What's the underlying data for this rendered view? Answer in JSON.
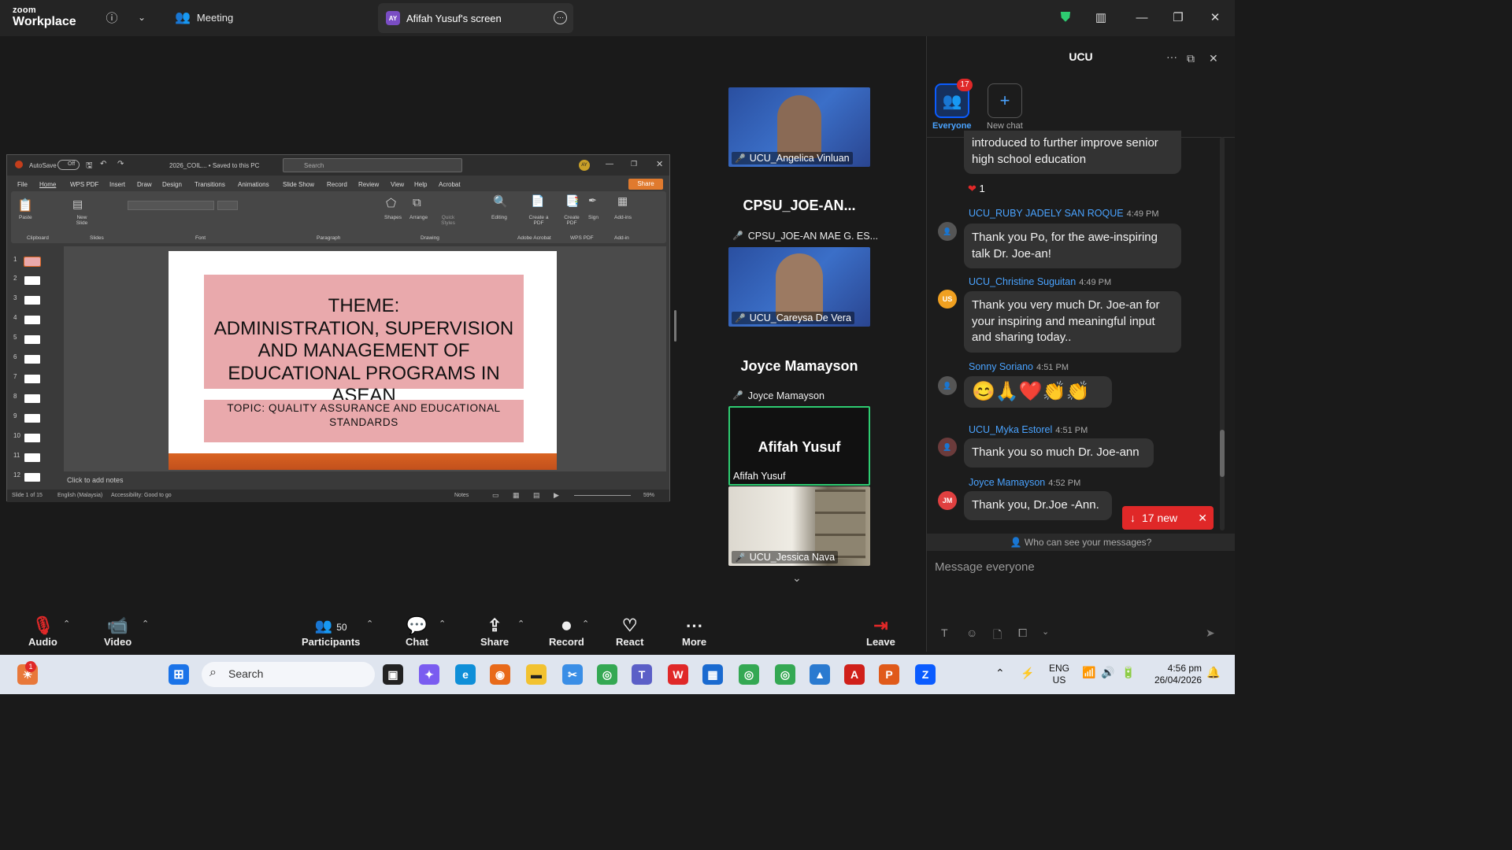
{
  "titlebar": {
    "logo_line1": "zoom",
    "logo_line2": "Workplace",
    "meeting_label": "Meeting",
    "screen_initials": "AY",
    "screen_label": "Afifah Yusuf's screen"
  },
  "ppt": {
    "autosave": "AutoSave",
    "autosave_state": "Off",
    "filename": "2026_COIL... • Saved to this PC",
    "search_placeholder": "Search",
    "share": "Share",
    "user_initials": "AY",
    "menu": [
      "File",
      "Home",
      "WPS PDF",
      "Insert",
      "Draw",
      "Design",
      "Transitions",
      "Animations",
      "Slide Show",
      "Record",
      "Review",
      "View",
      "Help",
      "Acrobat"
    ],
    "ribbon": {
      "paste": "Paste",
      "new_slide": "New Slide",
      "clipboard": "Clipboard",
      "slides": "Slides",
      "font": "Font",
      "paragraph": "Paragraph",
      "shapes": "Shapes",
      "arrange": "Arrange",
      "quick_styles": "Quick Styles",
      "drawing": "Drawing",
      "editing": "Editing",
      "create_pdf": "Create a PDF",
      "create_pdf2": "Create PDF",
      "sign": "Sign",
      "adobe": "Adobe Acrobat",
      "wps": "WPS PDF",
      "addins": "Add-ins",
      "addins_grp": "Add-in"
    },
    "slide_numbers": [
      "1",
      "2",
      "3",
      "4",
      "5",
      "6",
      "7",
      "8",
      "9",
      "10",
      "11",
      "12"
    ],
    "slide": {
      "theme": "THEME:\nADMINISTRATION, SUPERVISION\nAND MANAGEMENT OF\nEDUCATIONAL PROGRAMS IN ASEAN",
      "topic": "TOPIC: QUALITY ASSURANCE AND EDUCATIONAL\nSTANDARDS"
    },
    "notes": "Click to add notes",
    "status": {
      "slide": "Slide 1 of 15",
      "language": "English (Malaysia)",
      "accessibility": "Accessibility: Good to go",
      "notes": "Notes",
      "zoom": "59%"
    }
  },
  "gallery": {
    "angelica": "UCU_Angelica Vinluan",
    "cpsu_big": "CPSU_JOE-AN...",
    "cpsu_label": "CPSU_JOE-AN MAE G. ES...",
    "careysa": "UCU_Careysa De Vera",
    "joyce_big": "Joyce Mamayson",
    "joyce_label": "Joyce Mamayson",
    "afifah_big": "Afifah Yusuf",
    "afifah_label": "Afifah Yusuf",
    "jessica": "UCU_Jessica Nava"
  },
  "chat": {
    "title": "UCU",
    "everyone": "Everyone",
    "everyone_badge": "17",
    "new_chat": "New chat",
    "prev_text": "introduced to further improve senior high school education",
    "heart_count": "1",
    "messages": [
      {
        "name": "UCU_RUBY JADELY SAN ROQUE",
        "time": "4:49 PM",
        "text": "Thank you Po, for the awe-inspiring talk Dr. Joe-an!"
      },
      {
        "name": "UCU_Christine Suguitan",
        "time": "4:49 PM",
        "initials": "US",
        "text": "Thank you very much Dr. Joe-an for your inspiring and meaningful input and sharing today.."
      },
      {
        "name": "Sonny Soriano",
        "time": "4:51 PM",
        "text": "😊🙏❤️👏👏"
      },
      {
        "name": "UCU_Myka Estorel",
        "time": "4:51 PM",
        "text": "Thank you so much Dr. Joe-ann"
      },
      {
        "name": "Joyce Mamayson",
        "time": "4:52 PM",
        "initials": "JM",
        "text": "Thank you, Dr.Joe -Ann."
      }
    ],
    "new_badge": "17 new",
    "who_can_see": "Who can see your messages?",
    "input_placeholder": "Message everyone"
  },
  "toolbar": {
    "audio": "Audio",
    "video": "Video",
    "participants": "Participants",
    "participants_count": "50",
    "chat": "Chat",
    "share": "Share",
    "record": "Record",
    "react": "React",
    "more": "More",
    "leave": "Leave"
  },
  "taskbar": {
    "search": "Search",
    "lang1": "ENG",
    "lang2": "US",
    "time": "4:56 pm",
    "date": "26/04/2026",
    "notif": "1"
  },
  "colors": {
    "accent": "#0b5cff",
    "leave": "#e02828",
    "chat_name": "#4aa3ff",
    "active_border": "#2ecc71"
  }
}
